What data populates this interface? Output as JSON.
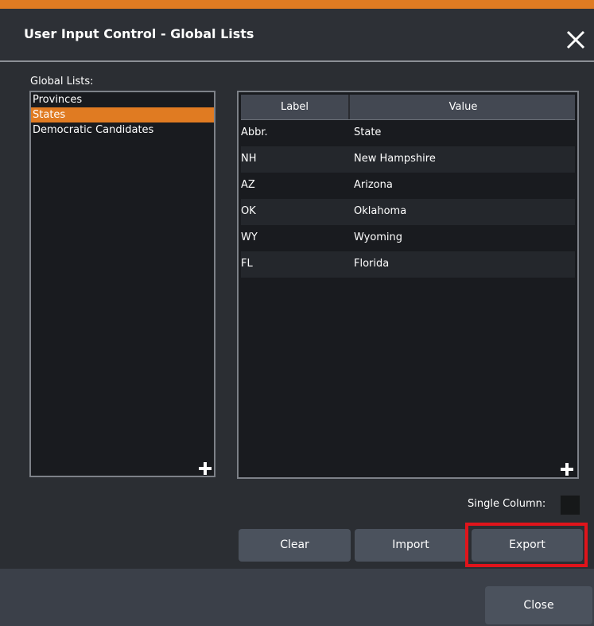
{
  "dialog": {
    "title": "User Input Control - Global Lists",
    "close_icon": "close-icon"
  },
  "lists": {
    "label": "Global Lists:",
    "items": [
      {
        "label": "Provinces",
        "selected": false
      },
      {
        "label": "States",
        "selected": true
      },
      {
        "label": "Democratic Candidates",
        "selected": false
      }
    ],
    "add_icon": "plus-icon"
  },
  "table": {
    "columns": [
      "Label",
      "Value"
    ],
    "rows": [
      {
        "label": "Abbr.",
        "value": "State"
      },
      {
        "label": "NH",
        "value": "New Hampshire"
      },
      {
        "label": "AZ",
        "value": "Arizona"
      },
      {
        "label": "OK",
        "value": "Oklahoma"
      },
      {
        "label": "WY",
        "value": "Wyoming"
      },
      {
        "label": "FL",
        "value": "Florida"
      }
    ],
    "add_icon": "plus-icon"
  },
  "options": {
    "single_column_label": "Single Column:",
    "single_column_checked": false
  },
  "buttons": {
    "clear": "Clear",
    "import": "Import",
    "export": "Export",
    "close": "Close"
  },
  "colors": {
    "accent": "#e07b22",
    "highlight": "#e0141b"
  }
}
